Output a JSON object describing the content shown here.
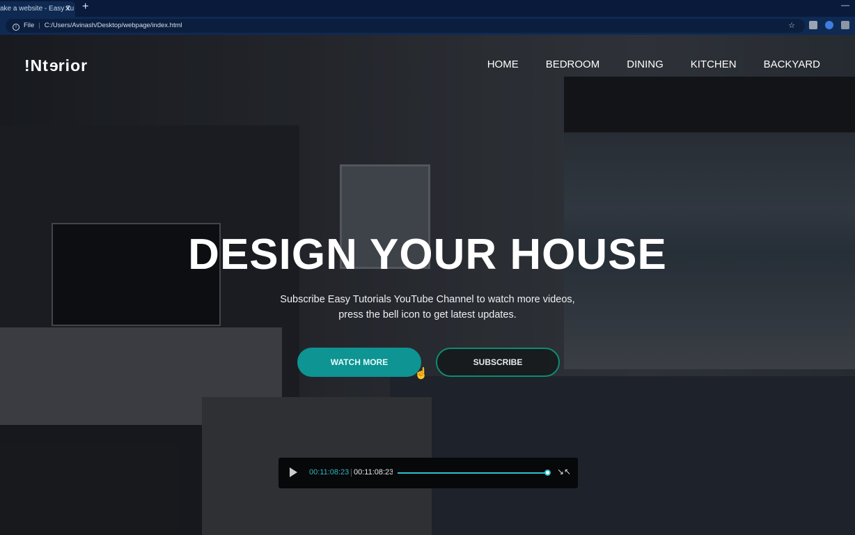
{
  "browser": {
    "tab_title": "ake a website - Easy Tu",
    "address_scheme": "File",
    "address": "C:/Users/Avinash/Desktop/webpage/index.html"
  },
  "site": {
    "logo": {
      "part1": "!Nt",
      "mirrored": "e",
      "part2": "rior"
    },
    "nav": [
      "HOME",
      "BEDROOM",
      "DINING",
      "KITCHEN",
      "BACKYARD"
    ],
    "headline": "DESIGN YOUR HOUSE",
    "subtitle_line1": "Subscribe Easy Tutorials YouTube Channel to watch more videos,",
    "subtitle_line2": "press the bell icon to get latest updates.",
    "buttons": {
      "watch": "WATCH MORE",
      "subscribe": "SUBSCRIBE"
    },
    "accent_color": "#0d9493"
  },
  "player": {
    "current_time": "00:11:08:23",
    "total_time": "00:11:08:23",
    "progress": 1.0
  }
}
